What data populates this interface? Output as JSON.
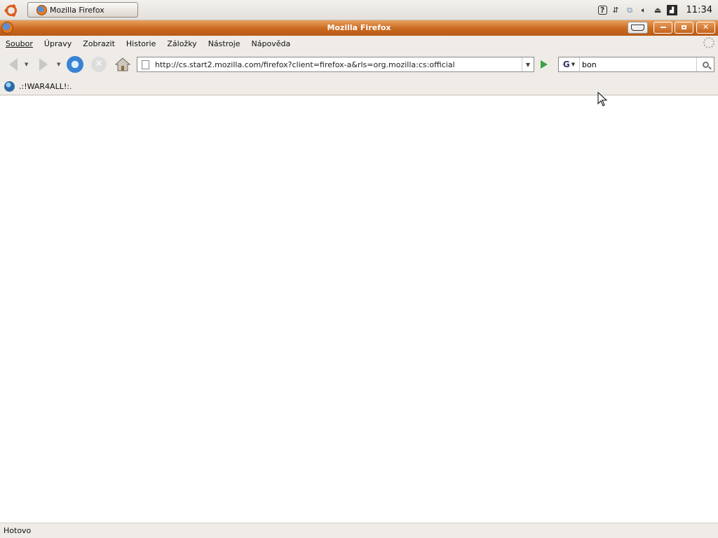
{
  "panel": {
    "taskbar_label": "Mozilla Firefox",
    "clock": "11:34"
  },
  "window": {
    "title": "Mozilla Firefox"
  },
  "menu": [
    {
      "label": "Soubor"
    },
    {
      "label": "Úpravy"
    },
    {
      "label": "Zobrazit"
    },
    {
      "label": "Historie"
    },
    {
      "label": "Záložky"
    },
    {
      "label": "Nástroje"
    },
    {
      "label": "Nápověda"
    }
  ],
  "navbar": {
    "url": "http://cs.start2.mozilla.com/firefox?client=firefox-a&rls=org.mozilla:cs:official",
    "search_engine": "G",
    "search_query": "bon"
  },
  "bookmarks": [
    {
      "label": ".:!WAR4ALL!:."
    }
  ],
  "status": {
    "text": "Hotovo"
  },
  "colors": {
    "title_bar": "#c9681f",
    "go_arrow": "#3aa345"
  }
}
